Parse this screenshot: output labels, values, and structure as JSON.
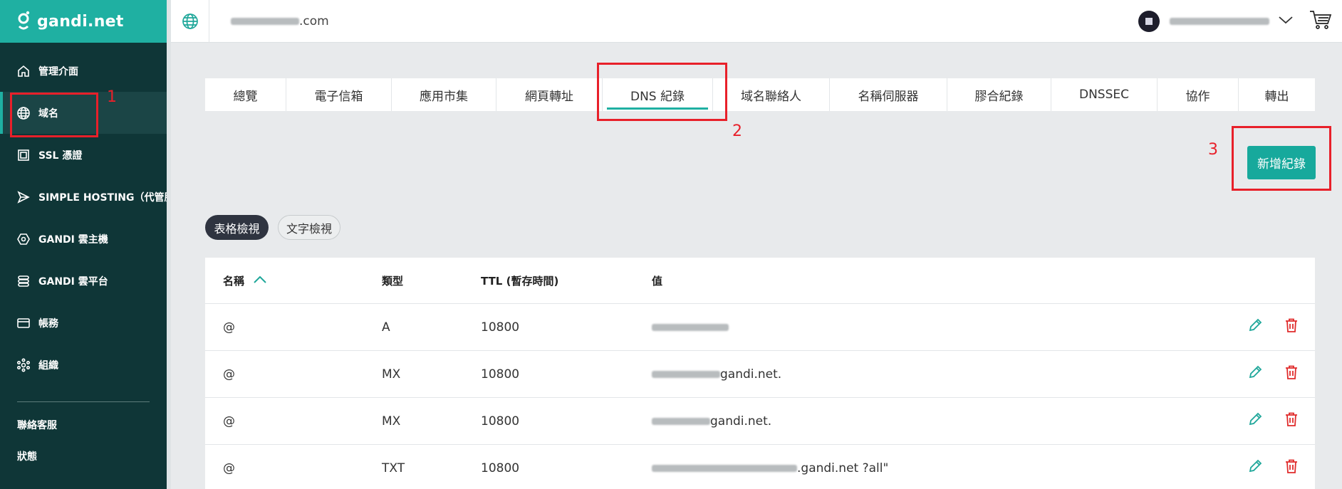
{
  "brand": {
    "name": "gandi.net",
    "color": "#1fb0a2",
    "sidebar_bg": "#0f3637"
  },
  "topbar": {
    "domain_suffix": ".com",
    "globe_icon": "globe-icon",
    "cart_icon": "cart-icon"
  },
  "sidebar": {
    "items": [
      {
        "label": "管理介面",
        "icon": "home-icon"
      },
      {
        "label": "域名",
        "icon": "globe-icon",
        "active": true
      },
      {
        "label": "SSL 憑證",
        "icon": "certificate-icon"
      },
      {
        "label": "SIMPLE HOSTING（代管服",
        "icon": "send-icon"
      },
      {
        "label": "GANDI 雲主機",
        "icon": "hexagon-icon"
      },
      {
        "label": "GANDI 雲平台",
        "icon": "stack-icon"
      },
      {
        "label": "帳務",
        "icon": "card-icon"
      },
      {
        "label": "組織",
        "icon": "network-icon"
      }
    ],
    "footer": [
      {
        "label": "聯絡客服"
      },
      {
        "label": "狀態"
      }
    ]
  },
  "tabs": [
    {
      "label": "總覽"
    },
    {
      "label": "電子信箱"
    },
    {
      "label": "應用市集"
    },
    {
      "label": "網頁轉址"
    },
    {
      "label": "DNS 紀錄",
      "active": true
    },
    {
      "label": "域名聯絡人"
    },
    {
      "label": "名稱伺服器"
    },
    {
      "label": "膠合紀錄"
    },
    {
      "label": "DNSSEC"
    },
    {
      "label": "協作"
    },
    {
      "label": "轉出"
    }
  ],
  "actions": {
    "add_record": "新增紀錄"
  },
  "views": {
    "table": "表格檢視",
    "text": "文字檢視"
  },
  "table": {
    "headers": {
      "name": "名稱",
      "type": "類型",
      "ttl": "TTL (暫存時間)",
      "value": "值"
    },
    "rows": [
      {
        "name": "@",
        "type": "A",
        "ttl": "10800",
        "value": ""
      },
      {
        "name": "@",
        "type": "MX",
        "ttl": "10800",
        "value": "gandi.net."
      },
      {
        "name": "@",
        "type": "MX",
        "ttl": "10800",
        "value": "gandi.net."
      },
      {
        "name": "@",
        "type": "TXT",
        "ttl": "10800",
        "value": ".gandi.net ?all\""
      }
    ]
  },
  "annotations": [
    {
      "label": "1"
    },
    {
      "label": "2"
    },
    {
      "label": "3"
    }
  ]
}
